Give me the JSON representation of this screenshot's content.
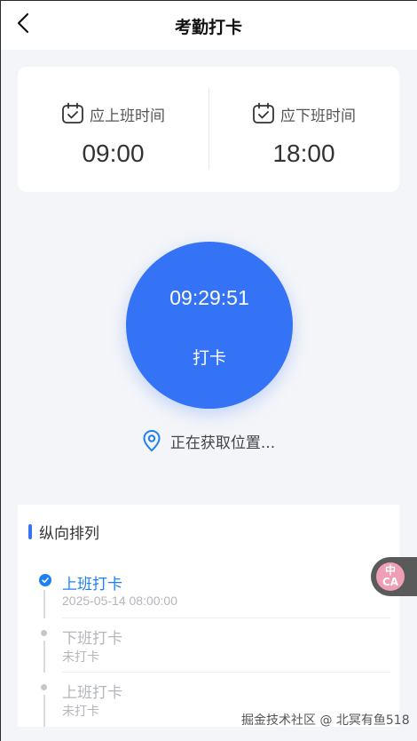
{
  "header": {
    "title": "考勤打卡"
  },
  "schedule": {
    "on_duty": {
      "label": "应上班时间",
      "time": "09:00"
    },
    "off_duty": {
      "label": "应下班时间",
      "time": "18:00"
    }
  },
  "punch": {
    "clock": "09:29:51",
    "label": "打卡"
  },
  "location": {
    "text": "正在获取位置..."
  },
  "list": {
    "title": "纵向排列",
    "items": [
      {
        "title": "上班打卡",
        "sub": "2025-05-14 08:00:00",
        "status": "done"
      },
      {
        "title": "下班打卡",
        "sub": "未打卡",
        "status": "pending"
      },
      {
        "title": "上班打卡",
        "sub": "未打卡",
        "status": "pending"
      }
    ]
  },
  "float_tool": {
    "line1": "中",
    "line2": "CA"
  },
  "watermark": "掘金技术社区 @ 北冥有鱼518",
  "colors": {
    "primary": "#3573f6",
    "active_timeline": "#1e7ff2",
    "background": "#f3f5f9"
  }
}
